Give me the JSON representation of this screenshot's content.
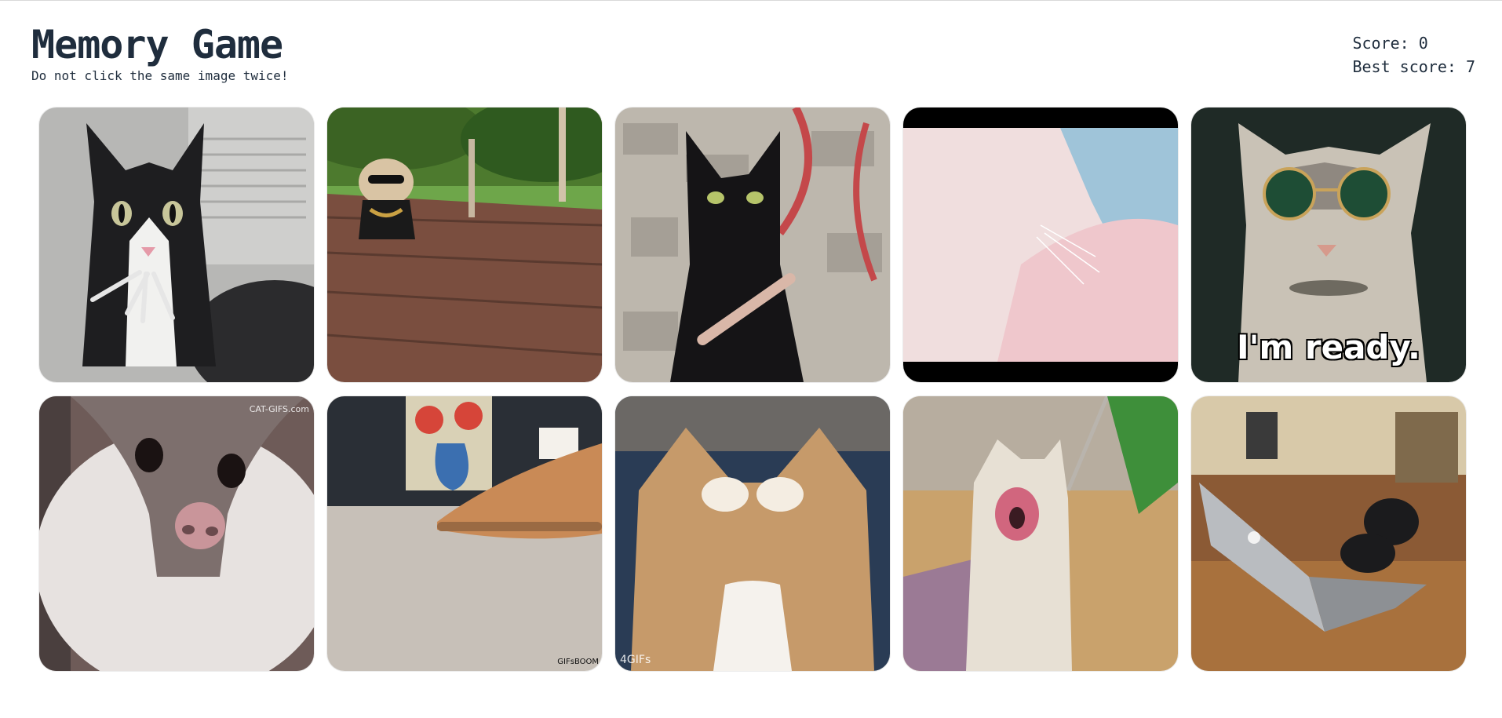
{
  "header": {
    "title": "Memory Game",
    "subtitle": "Do not click the same image twice!"
  },
  "scores": {
    "score_label": "Score: 0",
    "best_label": "Best score: 7"
  },
  "cards": [
    {
      "icon": "tuxedo-cat-smoking-image",
      "watermark": ""
    },
    {
      "icon": "cat-in-sunglasses-on-deck-image",
      "watermark": ""
    },
    {
      "icon": "black-cat-nail-file-image",
      "watermark": ""
    },
    {
      "icon": "white-cat-closeup-image",
      "watermark": ""
    },
    {
      "icon": "cat-with-round-glasses-image",
      "caption": "I'm ready."
    },
    {
      "icon": "cat-face-closeup-image",
      "watermark": "CAT-GIFS.com"
    },
    {
      "icon": "cat-paw-on-carpet-image",
      "watermark": "GIFsBOOM"
    },
    {
      "icon": "cat-covering-eyes-image",
      "watermark": "4GIFs"
    },
    {
      "icon": "cat-with-pink-mouth-image",
      "watermark": ""
    },
    {
      "icon": "cat-on-laptop-image",
      "watermark": ""
    }
  ],
  "colors": {
    "text": "#1f2d3d",
    "background": "#ffffff"
  }
}
